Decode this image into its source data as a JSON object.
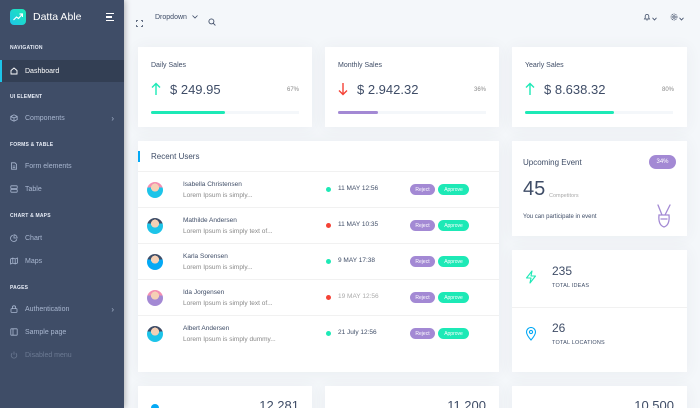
{
  "brand": {
    "title": "Datta Able"
  },
  "sidebar": {
    "sections": [
      {
        "caption": "Navigation"
      },
      {
        "caption": "UI Element"
      },
      {
        "caption": "Forms & Table"
      },
      {
        "caption": "Chart & Maps"
      },
      {
        "caption": "Pages"
      }
    ],
    "items": [
      {
        "label": "Dashboard",
        "icon": "home-icon",
        "active": true
      },
      {
        "label": "Components",
        "icon": "box-icon"
      },
      {
        "label": "Form elements",
        "icon": "file-text-icon"
      },
      {
        "label": "Table",
        "icon": "server-icon"
      },
      {
        "label": "Chart",
        "icon": "pie-chart-icon"
      },
      {
        "label": "Maps",
        "icon": "map-icon"
      },
      {
        "label": "Authentication",
        "icon": "lock-icon"
      },
      {
        "label": "Sample page",
        "icon": "sidebar-icon"
      },
      {
        "label": "Disabled menu",
        "icon": "power-icon",
        "disabled": true
      }
    ]
  },
  "header": {
    "dropdown_label": "Dropdown"
  },
  "sales": [
    {
      "title": "Daily Sales",
      "value": "$ 249.95",
      "percent": "67%",
      "progress": 0.67,
      "trend": "up",
      "color": "#1de9b6"
    },
    {
      "title": "Monthly Sales",
      "value": "$ 2.942.32",
      "percent": "36%",
      "progress": 0.36,
      "trend": "down",
      "color": "#a389d4"
    },
    {
      "title": "Yearly Sales",
      "value": "$ 8.638.32",
      "percent": "80%",
      "progress": 0.8,
      "trend": "up",
      "color": "#1de9b6"
    }
  ],
  "recent_users": {
    "title": "Recent Users",
    "reject_label": "Reject",
    "approve_label": "Approve",
    "rows": [
      {
        "name": "Isabella Christensen",
        "desc": "Lorem Ipsum is simply...",
        "date": "11 MAY 12:56",
        "status": "green"
      },
      {
        "name": "Mathilde Andersen",
        "desc": "Lorem Ipsum is simply text of...",
        "date": "11 MAY 10:35",
        "status": "red"
      },
      {
        "name": "Karla Sorensen",
        "desc": "Lorem Ipsum is simply...",
        "date": "9 MAY 17:38",
        "status": "green"
      },
      {
        "name": "Ida Jorgensen",
        "desc": "Lorem Ipsum is simply text of...",
        "date": "19 MAY 12:56",
        "status": "red",
        "muted": true
      },
      {
        "name": "Albert Andersen",
        "desc": "Lorem Ipsum is simply dummy...",
        "date": "21 July 12:56",
        "status": "green"
      }
    ]
  },
  "event": {
    "title": "Upcoming Event",
    "badge": "34%",
    "number": "45",
    "sub": "Competitors",
    "note": "You can participate in event"
  },
  "stats": [
    {
      "value": "235",
      "label": "Total Ideas",
      "icon": "zap-icon",
      "color": "#1de9b6"
    },
    {
      "value": "26",
      "label": "Total Locations",
      "icon": "map-pin-icon",
      "color": "#04a9f5"
    }
  ],
  "bottom_cards": [
    {
      "value": "12,281"
    },
    {
      "value": "11,200"
    },
    {
      "value": "10,500"
    }
  ],
  "colors": {
    "sidebar": "#3f4d67",
    "accent": "#1dc4e9",
    "success": "#1de9b6",
    "purple": "#a389d4",
    "danger": "#f44236"
  }
}
